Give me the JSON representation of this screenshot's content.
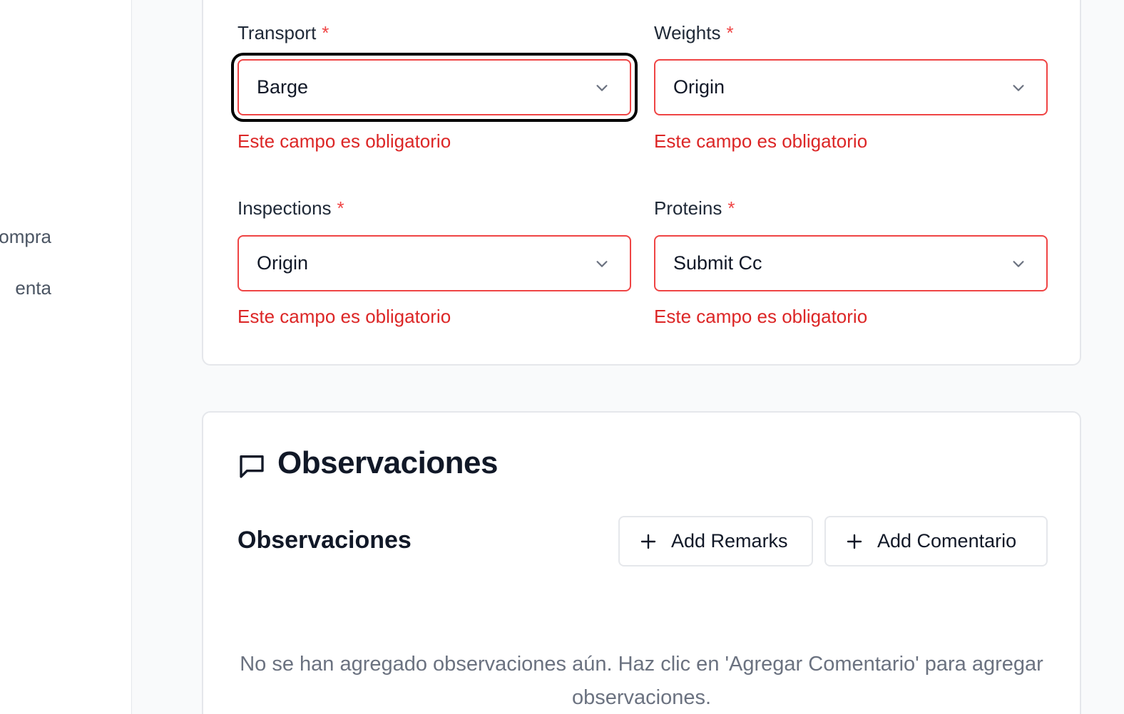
{
  "sidebar": {
    "items": [
      {
        "label": "ompra"
      },
      {
        "label": "enta"
      }
    ]
  },
  "form": {
    "required_marker": "*",
    "fields": [
      {
        "label": "Transport",
        "value": "Barge",
        "error": "Este campo es obligatorio"
      },
      {
        "label": "Weights",
        "value": "Origin",
        "error": "Este campo es obligatorio"
      },
      {
        "label": "Inspections",
        "value": "Origin",
        "error": "Este campo es obligatorio"
      },
      {
        "label": "Proteins",
        "value": "Submit Cc",
        "error": "Este campo es obligatorio"
      }
    ]
  },
  "observations": {
    "section_title": "Observaciones",
    "subtitle": "Observaciones",
    "add_remarks_label": "Add Remarks",
    "add_comment_label": "Add Comentario",
    "empty_message": "No se han agregado observaciones aún. Haz clic en 'Agregar Comentario' para agregar observaciones."
  },
  "colors": {
    "error": "#dc2626",
    "error_border": "#ef4444",
    "focus_ring": "#000000",
    "muted_text": "#6b7280"
  },
  "icons": {
    "select_chevron": "chevron-down-icon",
    "section_icon": "message-square-icon",
    "add_icon": "plus-icon"
  }
}
